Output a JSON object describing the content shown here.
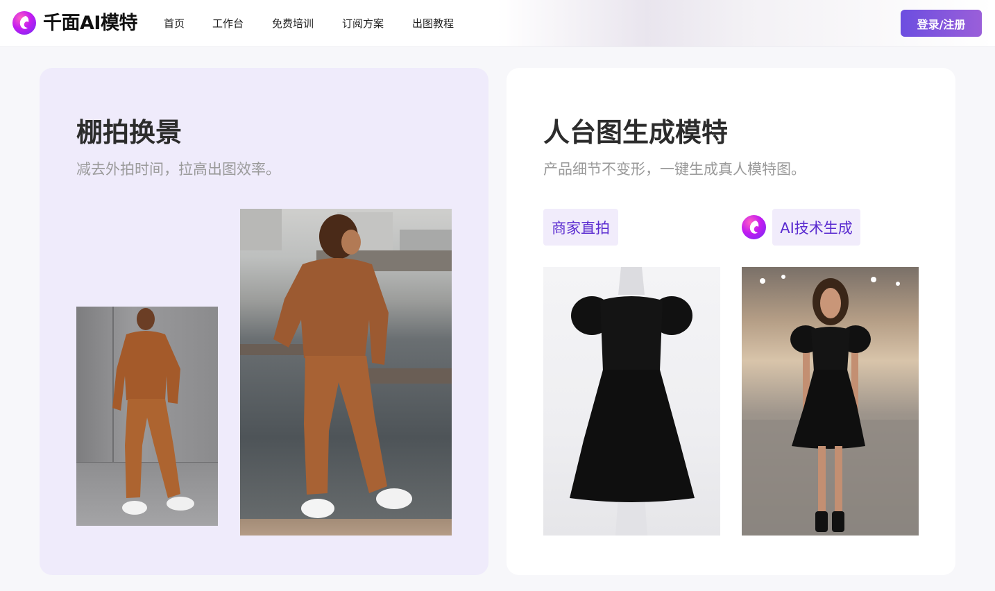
{
  "header": {
    "brand": "千面AI模特",
    "logo_icon": "brand-face-icon",
    "nav": [
      {
        "label": "首页"
      },
      {
        "label": "工作台"
      },
      {
        "label": "免费培训"
      },
      {
        "label": "订阅方案"
      },
      {
        "label": "出图教程"
      }
    ],
    "login_label": "登录/注册"
  },
  "cards": {
    "studio": {
      "title": "棚拍换景",
      "subtitle": "减去外拍时间，拉高出图效率。"
    },
    "mannequin": {
      "title": "人台图生成模特",
      "subtitle": "产品细节不变形，一键生成真人模特图。",
      "tag_merchant": "商家直拍",
      "tag_ai": "AI技术生成"
    }
  },
  "colors": {
    "accent": "#6c4ee0",
    "accent_end": "#9a5fd9",
    "tag_text": "#5a2bd0",
    "tag_bg": "#f1ecfb",
    "left_card_bg": "#efebfb",
    "right_card_bg": "#ffffff"
  }
}
